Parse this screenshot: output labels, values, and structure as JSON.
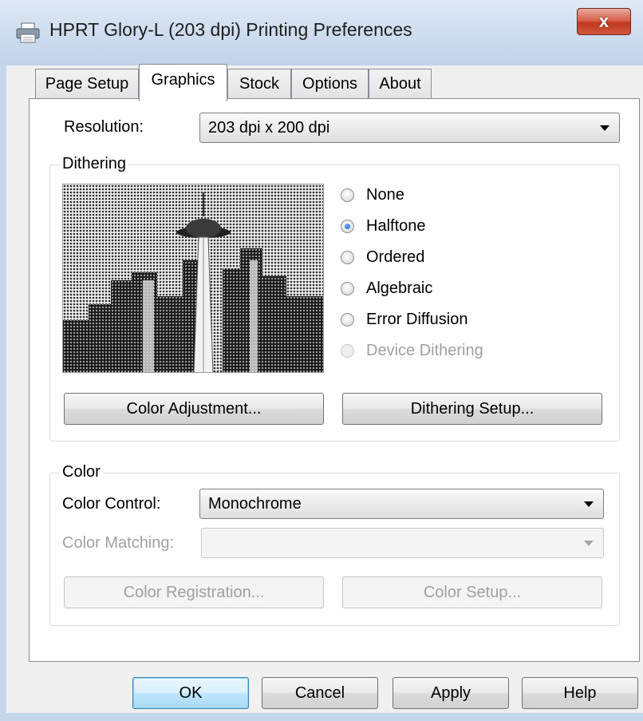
{
  "window": {
    "title": "HPRT Glory-L (203 dpi) Printing Preferences",
    "close_label": "x"
  },
  "tabs": [
    {
      "label": "Page Setup"
    },
    {
      "label": "Graphics",
      "active": true
    },
    {
      "label": "Stock"
    },
    {
      "label": "Options"
    },
    {
      "label": "About"
    }
  ],
  "resolution": {
    "label": "Resolution:",
    "value": "203 dpi x 200 dpi"
  },
  "dithering": {
    "group_title": "Dithering",
    "preview_icon": "city-skyline-halftone-preview",
    "options": [
      {
        "label": "None",
        "checked": false,
        "enabled": true
      },
      {
        "label": "Halftone",
        "checked": true,
        "enabled": true
      },
      {
        "label": "Ordered",
        "checked": false,
        "enabled": true
      },
      {
        "label": "Algebraic",
        "checked": false,
        "enabled": true
      },
      {
        "label": "Error Diffusion",
        "checked": false,
        "enabled": true
      },
      {
        "label": "Device Dithering",
        "checked": false,
        "enabled": false
      }
    ],
    "color_adjustment_label": "Color Adjustment...",
    "dithering_setup_label": "Dithering Setup..."
  },
  "color": {
    "group_title": "Color",
    "control_label": "Color Control:",
    "control_value": "Monochrome",
    "matching_label": "Color Matching:",
    "matching_value": "",
    "registration_label": "Color Registration...",
    "setup_label": "Color Setup..."
  },
  "footer": {
    "ok_label": "OK",
    "cancel_label": "Cancel",
    "apply_label": "Apply",
    "help_label": "Help"
  },
  "colors": {
    "accent": "#3c7fb1",
    "close_red": "#c0381f",
    "disabled_text": "#a0a0a0"
  }
}
